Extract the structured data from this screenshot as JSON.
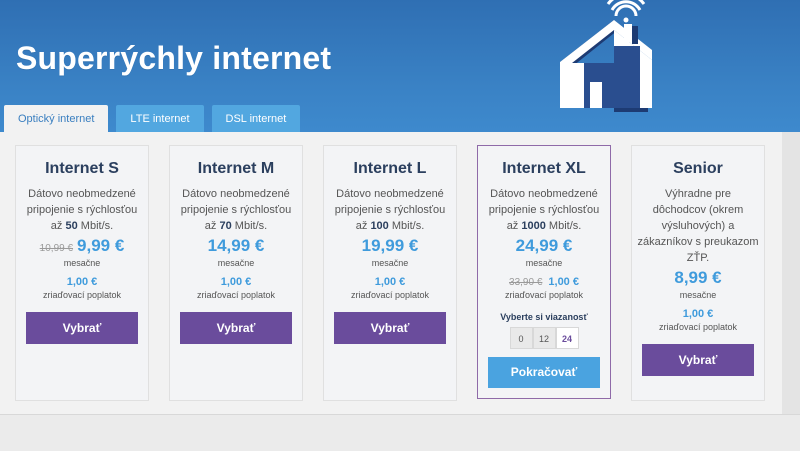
{
  "hero": {
    "title": "Superrýchly internet"
  },
  "tabs": [
    {
      "label": "Optický internet",
      "active": true
    },
    {
      "label": "LTE internet",
      "active": false
    },
    {
      "label": "DSL internet",
      "active": false
    }
  ],
  "plans": [
    {
      "name": "Internet S",
      "desc_pre": "Dátovo neobmedzené pripojenie s rýchlosťou až ",
      "speed": "50",
      "desc_post": " Mbit/s.",
      "old_price": "10,99 €",
      "price": "9,99 €",
      "price_period": "mesačne",
      "fee": "1,00 €",
      "fee_label": "zriaďovací poplatok",
      "button": "Vybrať"
    },
    {
      "name": "Internet M",
      "desc_pre": "Dátovo neobmedzené pripojenie s rýchlosťou až ",
      "speed": "70",
      "desc_post": " Mbit/s.",
      "price": "14,99 €",
      "price_period": "mesačne",
      "fee": "1,00 €",
      "fee_label": "zriaďovací poplatok",
      "button": "Vybrať"
    },
    {
      "name": "Internet L",
      "desc_pre": "Dátovo neobmedzené pripojenie s rýchlosťou až ",
      "speed": "100",
      "desc_post": " Mbit/s.",
      "price": "19,99 €",
      "price_period": "mesačne",
      "fee": "1,00 €",
      "fee_label": "zriaďovací poplatok",
      "button": "Vybrať"
    },
    {
      "name": "Internet XL",
      "desc_pre": "Dátovo neobmedzené pripojenie s rýchlosťou až ",
      "speed": "1000",
      "desc_post": " Mbit/s.",
      "price": "24,99 €",
      "price_period": "mesačne",
      "old_fee": "33,90 €",
      "fee": "1,00 €",
      "fee_label": "zriaďovací poplatok",
      "commitment_label": "Vyberte si viazanosť",
      "commitment_options": [
        "0",
        "12",
        "24"
      ],
      "commitment_selected": "24",
      "button": "Pokračovať"
    },
    {
      "name": "Senior",
      "desc": "Výhradne pre dôchodcov (okrem výsluhových) a zákazníkov s preukazom ZŤP.",
      "price": "8,99 €",
      "price_period": "mesačne",
      "fee": "1,00 €",
      "fee_label": "zriaďovací poplatok",
      "button": "Vybrať"
    }
  ],
  "colors": {
    "hero_blue": "#3a82c5",
    "tab_blue": "#52a7e0",
    "price_blue": "#3f9bdc",
    "button_purple": "#6a4c9c",
    "title_navy": "#2b3f5e",
    "highlight_border": "#8f6aa8"
  },
  "icons": {
    "hero_graphic": "house-wifi-icon"
  }
}
